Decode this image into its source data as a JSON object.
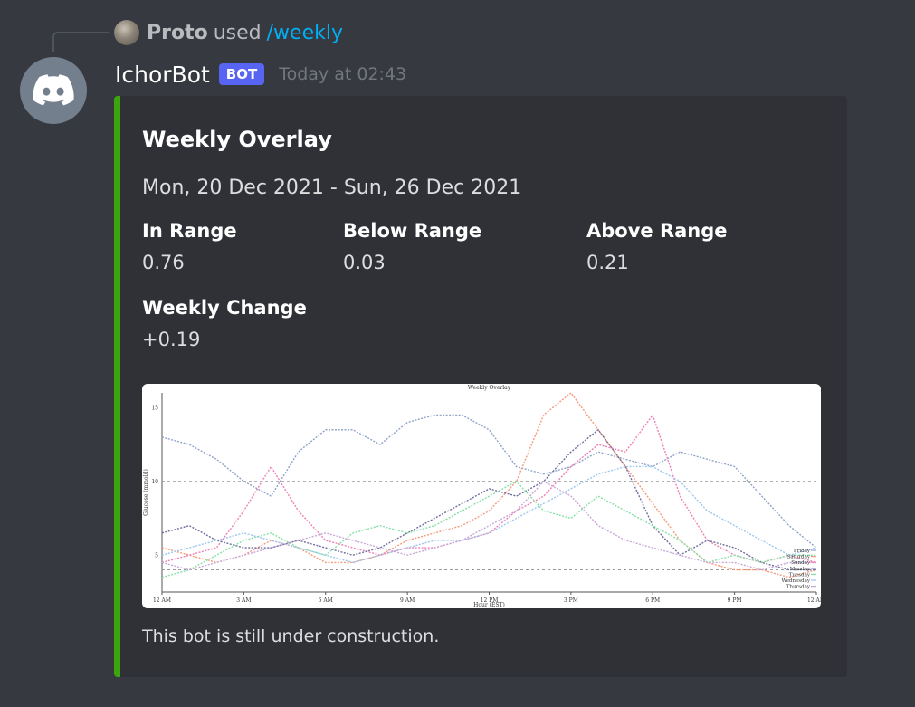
{
  "reply": {
    "username": "Proto",
    "used_text": "used",
    "command": "/weekly"
  },
  "message": {
    "avatar_icon": "discord-logo-icon",
    "username": "IchorBot",
    "bot_tag": "BOT",
    "timestamp": "Today at 02:43"
  },
  "embed": {
    "accent_color": "#3ba50d",
    "title": "Weekly Overlay",
    "description": "Mon, 20 Dec 2021 - Sun, 26 Dec 2021",
    "fields": [
      {
        "name": "In Range",
        "value": "0.76"
      },
      {
        "name": "Below Range",
        "value": "0.03"
      },
      {
        "name": "Above Range",
        "value": "0.21"
      },
      {
        "name": "Weekly Change",
        "value": "+0.19"
      }
    ],
    "footer": "This bot is still under construction."
  },
  "chart_data": {
    "type": "line",
    "title": "Weekly Overlay",
    "xlabel": "Hour (EST)",
    "ylabel": "Glucose (mmol/l)",
    "x_ticks": [
      "12 AM",
      "3 AM",
      "6 AM",
      "9 AM",
      "12 PM",
      "3 PM",
      "6 PM",
      "9 PM",
      "12 AM"
    ],
    "y_ticks": [
      5,
      10,
      15
    ],
    "xlim": [
      0,
      24
    ],
    "ylim": [
      2.5,
      16
    ],
    "threshold_lines": [
      4,
      10
    ],
    "x": [
      0,
      1,
      2,
      3,
      4,
      5,
      6,
      7,
      8,
      9,
      10,
      11,
      12,
      13,
      14,
      15,
      16,
      17,
      18,
      19,
      20,
      21,
      22,
      23,
      24
    ],
    "series": [
      {
        "name": "Friday",
        "color": "#8fa3c9",
        "values": [
          13,
          12.5,
          11.5,
          10,
          9,
          12,
          13.5,
          13.5,
          12.5,
          14,
          14.5,
          14.5,
          13.5,
          11,
          10.5,
          11,
          12,
          11.5,
          11,
          12,
          11.5,
          11,
          9,
          7,
          5.5
        ]
      },
      {
        "name": "Saturday",
        "color": "#f59a7a",
        "values": [
          5.5,
          5,
          4.5,
          5,
          6,
          5.5,
          4.5,
          4.5,
          5,
          6,
          6.5,
          7,
          8,
          10,
          14.5,
          16,
          13.5,
          11,
          8.5,
          6,
          4.5,
          4,
          4,
          3.5,
          4
        ]
      },
      {
        "name": "Sunday",
        "color": "#f07fb5",
        "values": [
          4.5,
          5,
          5.5,
          8,
          11,
          8,
          6,
          5.5,
          5,
          5.5,
          5.5,
          6,
          6.5,
          8,
          9,
          11,
          12.5,
          12,
          14.5,
          9,
          6,
          5,
          4.5,
          5,
          4.5
        ]
      },
      {
        "name": "Monday",
        "color": "#6e6e9e",
        "values": [
          6.5,
          7,
          6,
          5.5,
          5.5,
          6,
          5.5,
          5,
          5.5,
          6.5,
          7.5,
          8.5,
          9.5,
          9,
          10,
          12,
          13.5,
          11,
          7,
          5,
          6,
          5.5,
          4.5,
          4,
          4
        ]
      },
      {
        "name": "Tuesday",
        "color": "#86e0a6",
        "values": [
          3.5,
          4,
          5,
          6,
          6.5,
          5.5,
          5,
          6.5,
          7,
          6.5,
          7,
          8,
          9,
          10,
          8,
          7.5,
          9,
          8,
          7,
          6,
          4.5,
          5,
          4.5,
          5,
          5
        ]
      },
      {
        "name": "Wednesday",
        "color": "#9cc7ee",
        "values": [
          5,
          5.5,
          6,
          6.5,
          6,
          5.5,
          5,
          4.5,
          5,
          5.5,
          6,
          6,
          6.5,
          7.5,
          8.5,
          9.5,
          10.5,
          11,
          11,
          10,
          8,
          7,
          6,
          5,
          5.5
        ]
      },
      {
        "name": "Thursday",
        "color": "#c9a8d8",
        "values": [
          4.5,
          4,
          4.5,
          5,
          5.5,
          6,
          6.5,
          6,
          5.5,
          5,
          5.5,
          6,
          7,
          8,
          10,
          9,
          7,
          6,
          5.5,
          5,
          4.5,
          4.5,
          4,
          4.5,
          4.5
        ]
      }
    ],
    "legend_position": "right"
  }
}
